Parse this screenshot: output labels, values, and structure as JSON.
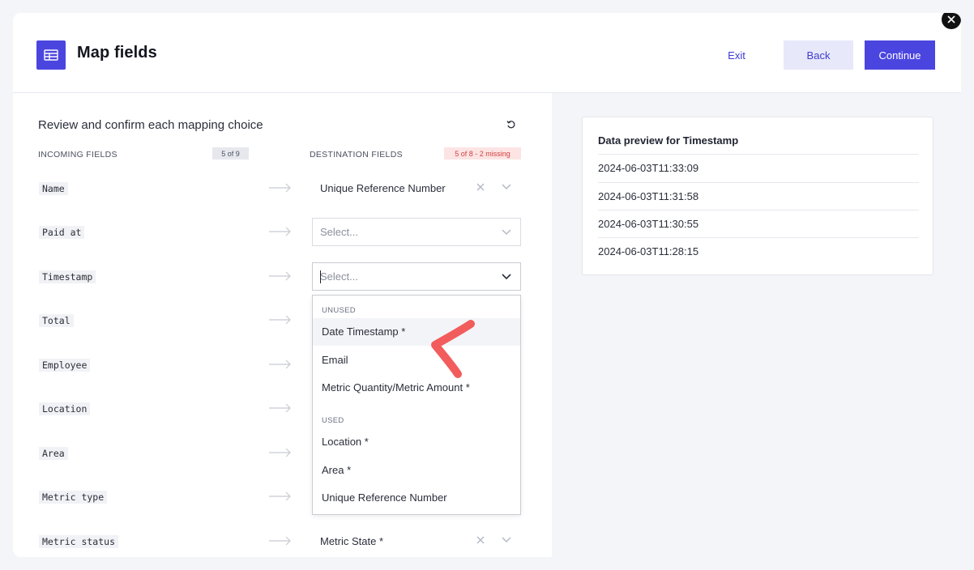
{
  "header": {
    "title": "Map fields",
    "exit_label": "Exit",
    "back_label": "Back",
    "continue_label": "Continue"
  },
  "mapping": {
    "subtitle": "Review and confirm each mapping choice",
    "incoming_header": "INCOMING FIELDS",
    "incoming_badge": "5 of 9",
    "destination_header": "DESTINATION FIELDS",
    "destination_badge": "5 of 8 - 2 missing",
    "rows": [
      {
        "field": "Name",
        "destination": "Unique Reference Number"
      },
      {
        "field": "Paid at",
        "placeholder": "Select..."
      },
      {
        "field": "Timestamp",
        "placeholder": "Select..."
      },
      {
        "field": "Total"
      },
      {
        "field": "Employee"
      },
      {
        "field": "Location"
      },
      {
        "field": "Area"
      },
      {
        "field": "Metric type"
      },
      {
        "field": "Metric status",
        "destination": "Metric State *"
      }
    ]
  },
  "dropdown": {
    "unused_label": "UNUSED",
    "unused_options": [
      "Date Timestamp *",
      "Email",
      "Metric Quantity/Metric Amount *"
    ],
    "used_label": "USED",
    "used_options": [
      "Location *",
      "Area *",
      "Unique Reference Number"
    ]
  },
  "preview": {
    "title": "Data preview for Timestamp",
    "values": [
      "2024-06-03T11:33:09",
      "2024-06-03T11:31:58",
      "2024-06-03T11:30:55",
      "2024-06-03T11:28:15"
    ]
  },
  "colors": {
    "accent": "#4b45e0",
    "annotation": "#f25c5c",
    "missing": "#d0413f"
  }
}
